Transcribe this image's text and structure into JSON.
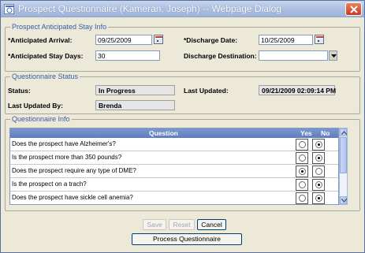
{
  "window": {
    "title": "Prospect Questionnaire (Kameran, Joseph) -- Webpage Dialog"
  },
  "stay_info": {
    "legend": "Prospect Anticipated Stay Info",
    "arrival_label": "*Anticipated Arrival:",
    "arrival_value": "09/25/2009",
    "discharge_label": "*Discharge Date:",
    "discharge_value": "10/25/2009",
    "stay_days_label": "*Anticipated Stay Days:",
    "stay_days_value": "30",
    "destination_label": "Discharge Destination:",
    "destination_value": ""
  },
  "status": {
    "legend": "Questionnaire Status",
    "status_label": "Status:",
    "status_value": "In Progress",
    "updated_label": "Last Updated:",
    "updated_value": "09/21/2009 02:09:14 PM",
    "updated_by_label": "Last Updated By:",
    "updated_by_value": "Brenda"
  },
  "questionnaire": {
    "legend": "Questionnaire Info",
    "col_question": "Question",
    "col_yes": "Yes",
    "col_no": "No",
    "rows": [
      {
        "question": "Does the prospect have Alzheimer's?",
        "answer": "No"
      },
      {
        "question": "Is the prospect more than 350 pounds?",
        "answer": "No"
      },
      {
        "question": "Does the prospect require any type of DME?",
        "answer": "Yes"
      },
      {
        "question": "Is the prospect on a trach?",
        "answer": "No"
      },
      {
        "question": "Does the prospect have sickle cell anemia?",
        "answer": "No"
      }
    ]
  },
  "buttons": {
    "save": "Save",
    "reset": "Reset",
    "cancel": "Cancel",
    "process": "Process Questionnaire"
  }
}
